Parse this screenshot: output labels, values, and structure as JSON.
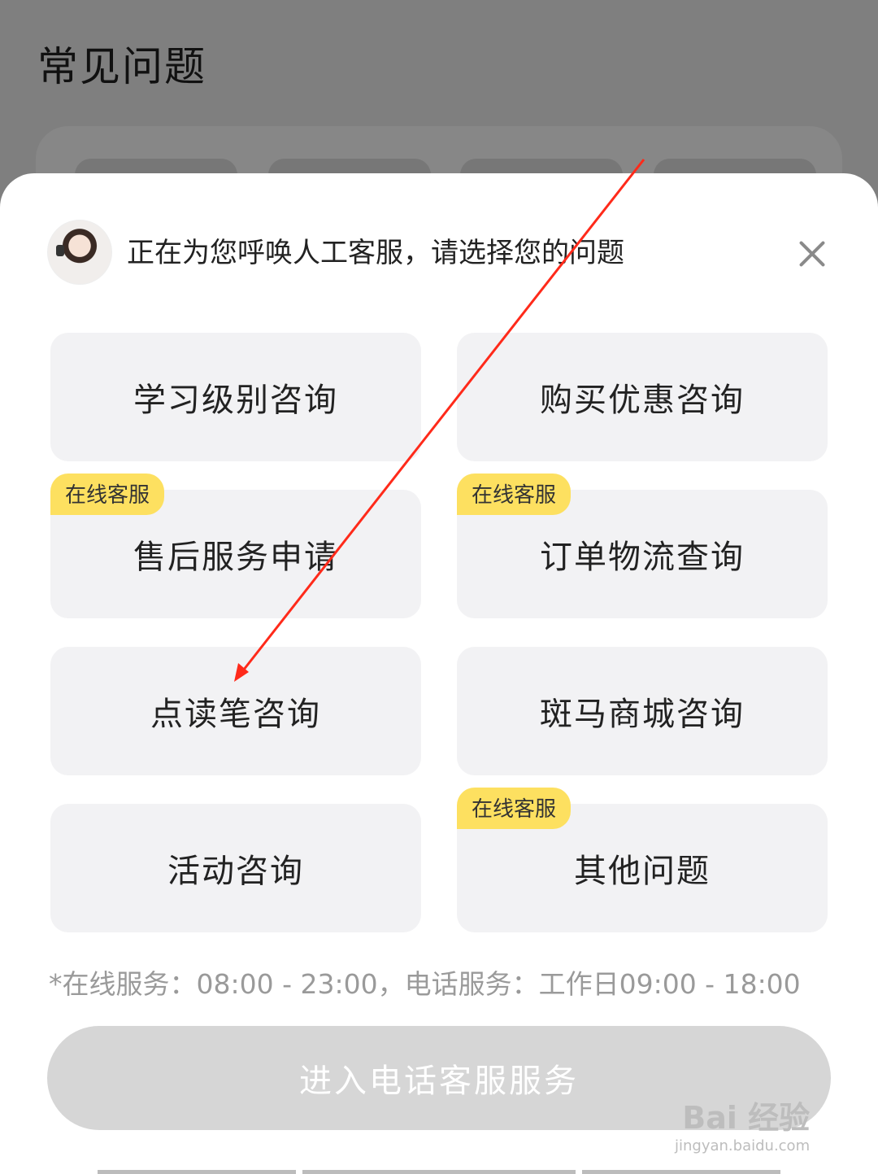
{
  "background": {
    "title": "常见问题"
  },
  "sheet": {
    "prompt": "正在为您呼唤人工客服，请选择您的问题",
    "options": [
      {
        "label": "学习级别咨询",
        "badge": ""
      },
      {
        "label": "购买优惠咨询",
        "badge": ""
      },
      {
        "label": "售后服务申请",
        "badge": "在线客服"
      },
      {
        "label": "订单物流查询",
        "badge": "在线客服"
      },
      {
        "label": "点读笔咨询",
        "badge": ""
      },
      {
        "label": "斑马商城咨询",
        "badge": ""
      },
      {
        "label": "活动咨询",
        "badge": ""
      },
      {
        "label": "其他问题",
        "badge": "在线客服"
      }
    ],
    "hours": "*在线服务：08:00 - 23:00，电话服务：工作日09:00 - 18:00",
    "cta_label": "进入电话客服服务"
  },
  "watermark": {
    "brand": "Bai 经验",
    "url": "jingyan.baidu.com"
  },
  "colors": {
    "overlay": "#7f7f7f",
    "badge": "#fde060",
    "option_bg": "#f2f2f4",
    "cta_bg": "#d6d6d6",
    "annotation_arrow": "#ff2a1a"
  },
  "icons": [
    "avatar-icon",
    "close-icon"
  ]
}
